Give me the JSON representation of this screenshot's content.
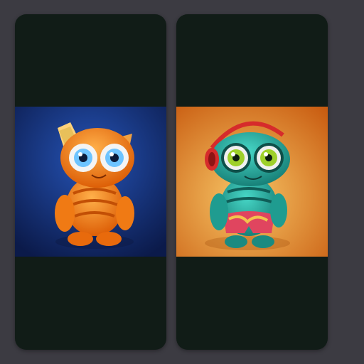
{
  "cards": [
    {
      "creature": "orange-creature",
      "colors": {
        "body": "#ff8a1c",
        "body_dark": "#d85e08",
        "bg_top": "#0d1f55",
        "bg_bottom": "#1d49a6",
        "eye": "#6ec4ff"
      },
      "caption": ""
    },
    {
      "creature": "teal-creature",
      "colors": {
        "body": "#2bb5a8",
        "body_dark": "#157f78",
        "bg_top": "#d36a12",
        "bg_bottom": "#f2b755",
        "eye": "#9ed02a",
        "headphones": "#d62b2b"
      },
      "caption": ""
    }
  ],
  "theme": {
    "page_bg": "#3c3b42",
    "card_bg": "#111c17"
  }
}
